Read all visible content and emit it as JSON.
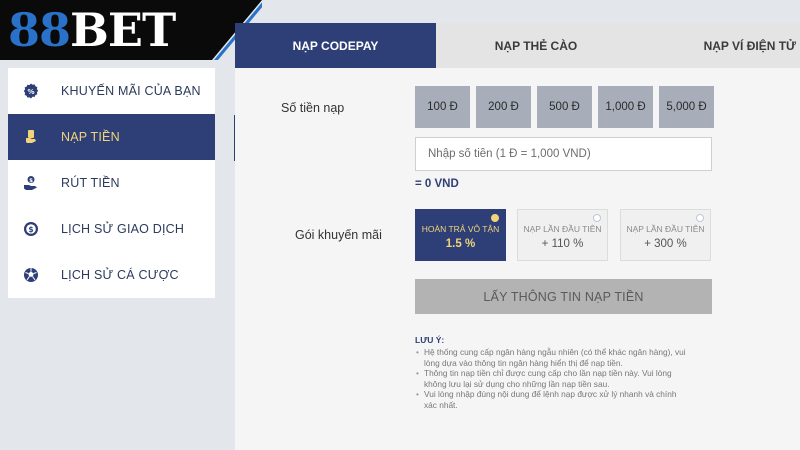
{
  "brand": {
    "logo_part1": "88",
    "logo_part2": "BET",
    "accent": "#2e3f77",
    "highlight": "#f1d47a",
    "logo_blue": "#2a72c9"
  },
  "sidebar": {
    "items": [
      {
        "label": "KHUYẾN MÃI CỦA BẠN",
        "icon": "promo-gear-icon",
        "active": false
      },
      {
        "label": "NẠP TIỀN",
        "icon": "deposit-hand-icon",
        "active": true
      },
      {
        "label": "RÚT TIỀN",
        "icon": "withdraw-hand-icon",
        "active": false
      },
      {
        "label": "LỊCH SỬ GIAO DỊCH",
        "icon": "dollar-history-icon",
        "active": false
      },
      {
        "label": "LỊCH SỬ CÁ CƯỢC",
        "icon": "soccer-ball-icon",
        "active": false
      }
    ]
  },
  "tabs": [
    {
      "label": "NẠP CODEPAY",
      "active": true
    },
    {
      "label": "NẠP THẺ CÀO",
      "active": false
    },
    {
      "label": "NẠP VÍ ĐIỆN TỬ",
      "active": false
    }
  ],
  "form": {
    "amount_label": "Số tiền nạp",
    "amount_options": [
      "100 Đ",
      "200 Đ",
      "500 Đ",
      "1,000 Đ",
      "5,000 Đ"
    ],
    "input_placeholder": "Nhập số tiền (1 Đ = 1,000 VND)",
    "input_value": "",
    "equals_text": "= 0 VND",
    "promo_label": "Gói khuyến mãi",
    "promos": [
      {
        "name": "HOÀN TRẢ VÔ TẬN",
        "value": "1.5 %",
        "selected": true
      },
      {
        "name": "NẠP LẦN ĐẦU TIÊN",
        "value": "+ 110 %",
        "selected": false
      },
      {
        "name": "NẠP LẦN ĐẦU TIÊN",
        "value": "+ 300 %",
        "selected": false
      }
    ],
    "submit_label": "LẤY THÔNG TIN NẠP TIỀN"
  },
  "notes": {
    "title": "LƯU Ý:",
    "lines": [
      "Hệ thống cung cấp ngân hàng ngẫu nhiên (có thể khác ngân hàng), vui",
      "lòng dựa vào thông tin ngân hàng hiển thị để nạp tiền.",
      "Thông tin nạp tiền chỉ được cung cấp cho lần nạp tiền này. Vui lòng",
      "không lưu lại sử dụng cho những lần nạp tiền sau.",
      "Vui lòng nhập đúng nội dung để lệnh nạp được xử lý nhanh và chính",
      "xác nhất."
    ]
  }
}
